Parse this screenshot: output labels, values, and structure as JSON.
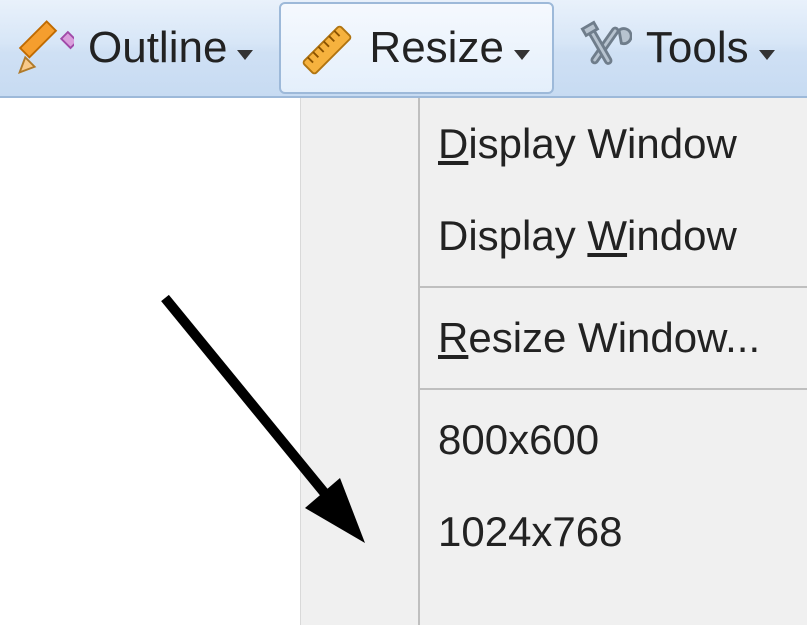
{
  "toolbar": {
    "outline_label": "Outline",
    "resize_label": "Resize",
    "tools_label": "Tools"
  },
  "menu": {
    "display_window_size": "isplay Window",
    "display_window_size_mn": "D",
    "display_window_small": "Display ",
    "display_window_small_mn": "W",
    "display_window_small_tail": "indow",
    "resize_window": "esize Window...",
    "resize_window_mn": "R",
    "preset_800": "800x600",
    "preset_1024": "1024x768"
  },
  "icons": {
    "pencil": "pencil-icon",
    "ruler": "ruler-icon",
    "tools": "tools-icon"
  }
}
